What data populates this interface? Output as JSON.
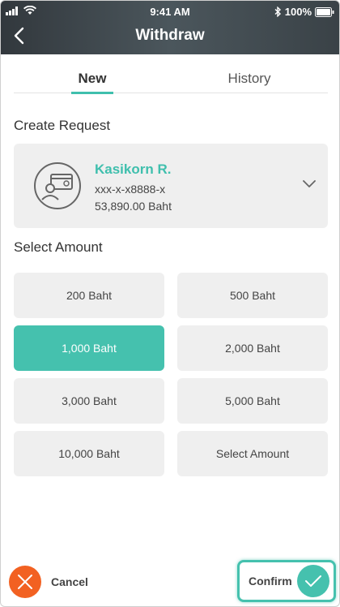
{
  "status_bar": {
    "time": "9:41 AM",
    "battery": "100%",
    "icons": [
      "signal-icon",
      "wifi-icon",
      "bluetooth-icon",
      "battery-icon"
    ]
  },
  "header": {
    "title": "Withdraw",
    "back_icon": "chevron-left-icon"
  },
  "tabs": [
    {
      "label": "New",
      "active": true
    },
    {
      "label": "History",
      "active": false
    }
  ],
  "create_request": {
    "section_title": "Create Request",
    "account": {
      "name": "Kasikorn R.",
      "number": "xxx-x-x8888-x",
      "balance": "53,890.00 Baht",
      "icon": "account-card-icon"
    }
  },
  "select_amount": {
    "section_title": "Select Amount",
    "options": [
      {
        "label": "200 Baht",
        "selected": false
      },
      {
        "label": "500 Baht",
        "selected": false
      },
      {
        "label": "1,000 Baht",
        "selected": true
      },
      {
        "label": "2,000 Baht",
        "selected": false
      },
      {
        "label": "3,000 Baht",
        "selected": false
      },
      {
        "label": "5,000 Baht",
        "selected": false
      },
      {
        "label": "10,000 Baht",
        "selected": false
      },
      {
        "label": "Select Amount",
        "selected": false
      }
    ]
  },
  "actions": {
    "cancel_label": "Cancel",
    "confirm_label": "Confirm"
  },
  "colors": {
    "accent": "#45c1ae",
    "cancel": "#f26122",
    "card_bg": "#efefef"
  }
}
